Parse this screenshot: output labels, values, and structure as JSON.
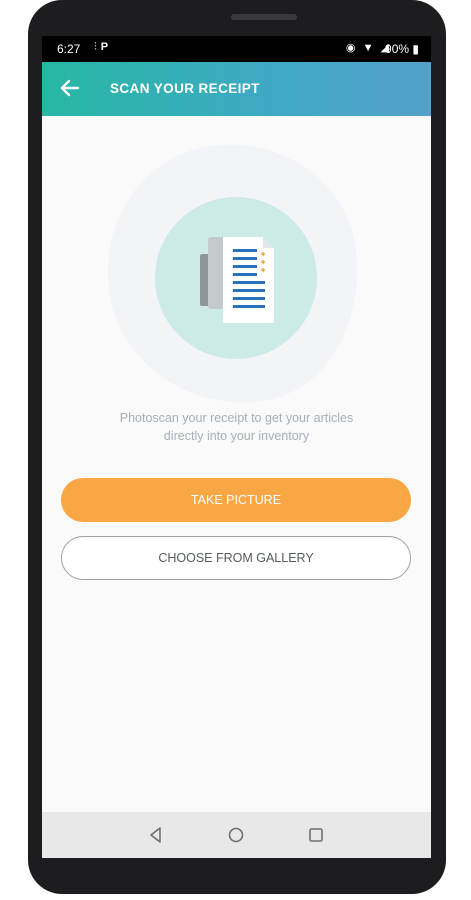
{
  "status_bar": {
    "time": "6:27",
    "left_icons": [
      "pin-icon",
      "parking-icon"
    ],
    "right_icons": [
      "alarm-icon",
      "wifi-icon",
      "signal-icon"
    ],
    "battery": "90%"
  },
  "app_bar": {
    "back_icon": "arrow-left-icon",
    "title": "SCAN YOUR RECEIPT",
    "gradient": [
      "#27b8a4",
      "#55a0cc"
    ]
  },
  "illustration": {
    "icon": "receipt-scan-icon",
    "circle_color": "#cdebe6"
  },
  "caption": {
    "line1": "Photoscan your receipt to get your articles",
    "line2": "directly into your inventory"
  },
  "buttons": {
    "take_picture": "TAKE PICTURE",
    "choose_gallery": "CHOOSE FROM GALLERY"
  },
  "colors": {
    "accent_orange": "#f9a645"
  },
  "nav_bar": {
    "back": "nav-back-icon",
    "home": "nav-home-icon",
    "recents": "nav-recents-icon"
  }
}
